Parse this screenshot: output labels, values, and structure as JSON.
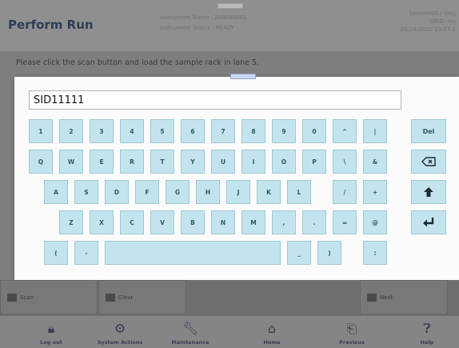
{
  "header": {
    "title": "Perform Run",
    "instrument_name": "Instrument Name : 200680001",
    "instrument_status": "Instrument Status : READY",
    "user_line1": "SeniorHSS / Sieg",
    "user_line2": "GRID: res",
    "datetime": "09/24/2020 13:27:1"
  },
  "instruction": "Please click the scan button and load the sample rack in lane 5.",
  "keyboard": {
    "input_value": "SID11111",
    "row1": [
      "1",
      "2",
      "3",
      "4",
      "5",
      "6",
      "7",
      "8",
      "9",
      "0",
      "^",
      "|"
    ],
    "row2": [
      "Q",
      "W",
      "E",
      "R",
      "T",
      "Y",
      "U",
      "I",
      "O",
      "P",
      "\\",
      "&"
    ],
    "row3": [
      "A",
      "S",
      "D",
      "F",
      "G",
      "H",
      "J",
      "K",
      "L",
      "/",
      "+"
    ],
    "row4": [
      "Z",
      "X",
      "C",
      "V",
      "B",
      "N",
      "M",
      ",",
      ".",
      "=",
      "@"
    ],
    "row5": [
      "(",
      "-",
      "",
      "_",
      ")",
      ":"
    ],
    "del_label": "Del"
  },
  "actionbar": {
    "scan_label": "Scan",
    "clear_label": "Clear",
    "next_label": "Next"
  },
  "nav": {
    "logout": "Log out",
    "system_actions": "System Actions",
    "maintenance": "Maintenance",
    "home": "Home",
    "previous": "Previous",
    "help": "Help"
  },
  "colors": {
    "key_fill": "#c3e4ee",
    "key_border": "#9fc8d4",
    "title": "#2f3d55"
  }
}
